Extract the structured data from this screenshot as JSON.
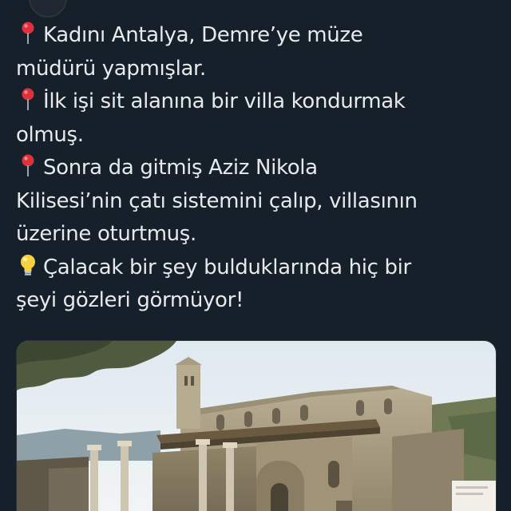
{
  "tweet": {
    "lines": [
      {
        "icon": "pushpin-icon",
        "text": "Kadını Antalya, Demre’ye müze"
      },
      {
        "icon": "",
        "text": "müdürü yapmışlar."
      },
      {
        "icon": "pushpin-icon",
        "text": "İlk işi sit alanına bir villa kondurmak"
      },
      {
        "icon": "",
        "text": "olmuş."
      },
      {
        "icon": "pushpin-icon",
        "text": "Sonra da gitmiş Aziz Nikola"
      },
      {
        "icon": "",
        "text": "Kilisesi’nin çatı sistemini çalıp, villasının"
      },
      {
        "icon": "",
        "text": "üzerine oturtmuş."
      },
      {
        "icon": "light-bulb-icon",
        "text": "Çalacak bir şey bulduklarında hiç bir"
      },
      {
        "icon": "",
        "text": "şeyi gözleri görmüyor!"
      }
    ]
  },
  "colors": {
    "background": "#15202b",
    "text": "#e7e9ea",
    "pin": "#e0303b",
    "bulb": "#f7d23e"
  },
  "media": {
    "subject": "church-ruins-photo"
  }
}
